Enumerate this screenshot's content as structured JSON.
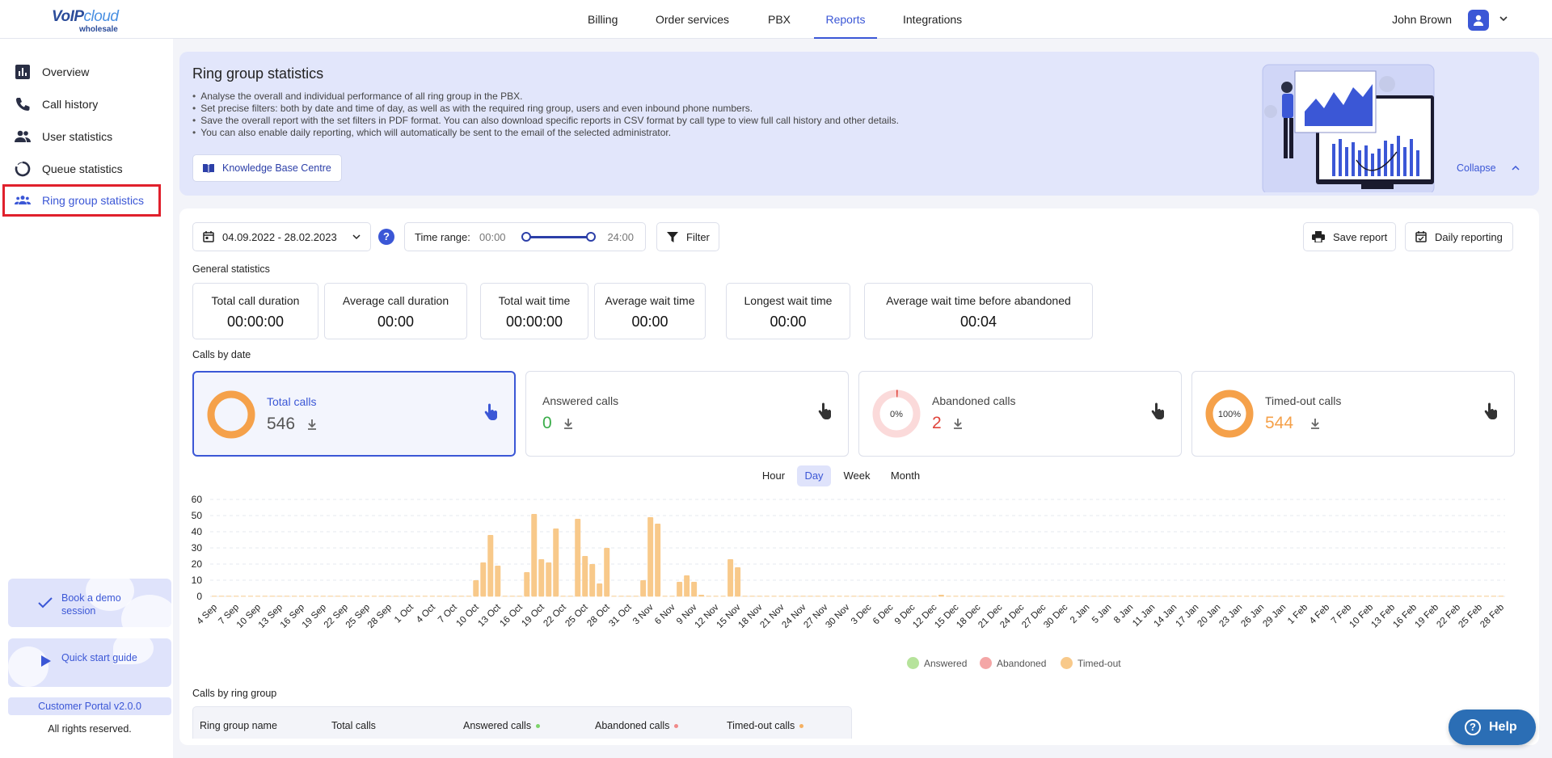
{
  "brand": {
    "logo_main": "VoIP",
    "logo_accent": "cloud",
    "logo_sub": "wholesale"
  },
  "nav": {
    "items": [
      {
        "label": "Billing"
      },
      {
        "label": "Order services"
      },
      {
        "label": "PBX"
      },
      {
        "label": "Reports",
        "active": true
      },
      {
        "label": "Integrations"
      }
    ],
    "user_name": "John Brown"
  },
  "sidebar": {
    "items": [
      {
        "label": "Overview",
        "icon": "bar-chart-icon"
      },
      {
        "label": "Call history",
        "icon": "phone-icon"
      },
      {
        "label": "User statistics",
        "icon": "users-icon"
      },
      {
        "label": "Queue statistics",
        "icon": "queue-icon"
      },
      {
        "label": "Ring group statistics",
        "icon": "group-icon",
        "active": true
      }
    ],
    "promo_demo": "Book a demo session",
    "promo_guide": "Quick start guide",
    "version": "Customer Portal v2.0.0",
    "rights": "All rights reserved."
  },
  "banner": {
    "title": "Ring group statistics",
    "bullets": [
      "Analyse the overall and individual performance of all ring group in the PBX.",
      "Set precise filters: both by date and time of day, as well as with the required ring group, users and even inbound phone numbers.",
      "Save the overall report with the set filters in PDF format. You can also download specific reports in CSV format by call type to view full call history and other details.",
      "You can also enable daily reporting, which will automatically be sent to the email of the selected administrator."
    ],
    "kb_button": "Knowledge Base Centre",
    "collapse": "Collapse"
  },
  "controls": {
    "date_range": "04.09.2022 - 28.02.2023",
    "help": "?",
    "time_range_label": "Time range:",
    "time_from": "00:00",
    "time_to": "24:00",
    "filter": "Filter",
    "save_report": "Save report",
    "daily_reporting": "Daily reporting"
  },
  "general": {
    "title": "General statistics",
    "stats": [
      {
        "label": "Total call duration",
        "value": "00:00:00"
      },
      {
        "label": "Average call duration",
        "value": "00:00"
      },
      {
        "label": "Total wait time",
        "value": "00:00:00"
      },
      {
        "label": "Average wait time",
        "value": "00:00"
      },
      {
        "label": "Longest wait time",
        "value": "00:00"
      },
      {
        "label": "Average wait time before abandoned",
        "value": "00:04"
      }
    ]
  },
  "calls_by_date": {
    "title": "Calls by date",
    "cards": [
      {
        "label": "Total calls",
        "value": "546",
        "color": "#f5a14a"
      },
      {
        "label": "Answered calls",
        "value": "0",
        "color": "#3aad4a"
      },
      {
        "label": "Abandoned calls",
        "value": "2",
        "pct": "0%",
        "color": "#e0453c"
      },
      {
        "label": "Timed-out calls",
        "value": "544",
        "pct": "100%",
        "color": "#f5a14a"
      }
    ],
    "tabs": [
      {
        "label": "Hour"
      },
      {
        "label": "Day",
        "active": true
      },
      {
        "label": "Week"
      },
      {
        "label": "Month"
      }
    ]
  },
  "chart_data": {
    "type": "bar",
    "ylim": [
      0,
      60
    ],
    "yticks": [
      0,
      10,
      20,
      30,
      40,
      50,
      60
    ],
    "x_labels": [
      "4 Sep",
      "7 Sep",
      "10 Sep",
      "13 Sep",
      "16 Sep",
      "19 Sep",
      "22 Sep",
      "25 Sep",
      "28 Sep",
      "1 Oct",
      "4 Oct",
      "7 Oct",
      "10 Oct",
      "13 Oct",
      "16 Oct",
      "19 Oct",
      "22 Oct",
      "25 Oct",
      "28 Oct",
      "31 Oct",
      "3 Nov",
      "6 Nov",
      "9 Nov",
      "12 Nov",
      "15 Nov",
      "18 Nov",
      "21 Nov",
      "24 Nov",
      "27 Nov",
      "30 Nov",
      "3 Dec",
      "6 Dec",
      "9 Dec",
      "12 Dec",
      "15 Dec",
      "18 Dec",
      "21 Dec",
      "24 Dec",
      "27 Dec",
      "30 Dec",
      "2 Jan",
      "5 Jan",
      "8 Jan",
      "11 Jan",
      "14 Jan",
      "17 Jan",
      "20 Jan",
      "23 Jan",
      "26 Jan",
      "29 Jan",
      "1 Feb",
      "4 Feb",
      "7 Feb",
      "10 Feb",
      "13 Feb",
      "16 Feb",
      "19 Feb",
      "22 Feb",
      "25 Feb",
      "28 Feb"
    ],
    "series": [
      {
        "name": "Timed-out",
        "color": "#f8c98a",
        "bars": [
          {
            "x": "10 Oct",
            "y": 10
          },
          {
            "x": "11 Oct",
            "y": 21
          },
          {
            "x": "12 Oct",
            "y": 38
          },
          {
            "x": "13 Oct",
            "y": 19
          },
          {
            "x": "17 Oct",
            "y": 15
          },
          {
            "x": "18 Oct",
            "y": 51
          },
          {
            "x": "19 Oct",
            "y": 23
          },
          {
            "x": "20 Oct",
            "y": 21
          },
          {
            "x": "21 Oct",
            "y": 42
          },
          {
            "x": "24 Oct",
            "y": 48
          },
          {
            "x": "25 Oct",
            "y": 25
          },
          {
            "x": "26 Oct",
            "y": 20
          },
          {
            "x": "27 Oct",
            "y": 8
          },
          {
            "x": "28 Oct",
            "y": 30
          },
          {
            "x": "2 Nov",
            "y": 10
          },
          {
            "x": "3 Nov",
            "y": 49
          },
          {
            "x": "4 Nov",
            "y": 45
          },
          {
            "x": "7 Nov",
            "y": 9
          },
          {
            "x": "8 Nov",
            "y": 13
          },
          {
            "x": "9 Nov",
            "y": 9
          },
          {
            "x": "10 Nov",
            "y": 1
          },
          {
            "x": "14 Nov",
            "y": 23
          },
          {
            "x": "15 Nov",
            "y": 18
          },
          {
            "x": "13 Dec",
            "y": 1
          }
        ]
      }
    ],
    "legend": [
      {
        "name": "Answered",
        "color": "#b6e39b"
      },
      {
        "name": "Abandoned",
        "color": "#f4a6a6"
      },
      {
        "name": "Timed-out",
        "color": "#f8c98a"
      }
    ]
  },
  "ring_table": {
    "title": "Calls by ring group",
    "headers": [
      {
        "label": "Ring group name"
      },
      {
        "label": "Total calls"
      },
      {
        "label": "Answered calls",
        "dot": "#7cd36a"
      },
      {
        "label": "Abandoned calls",
        "dot": "#f08a8a"
      },
      {
        "label": "Timed-out calls",
        "dot": "#f5b062"
      }
    ]
  },
  "help_button": "Help"
}
